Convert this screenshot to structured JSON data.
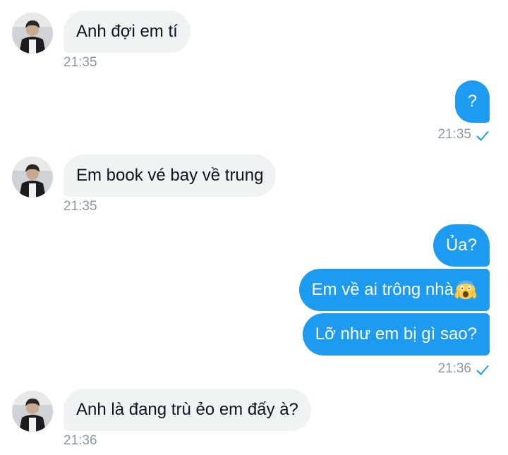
{
  "colors": {
    "outgoing_bubble": "#1d9bf0",
    "incoming_bubble": "#eff3f4",
    "timestamp": "#8b98a5",
    "read_check": "#1d9bf0"
  },
  "messages": [
    {
      "direction": "incoming",
      "text": "Anh đợi em tí",
      "time": "21:35"
    },
    {
      "direction": "outgoing",
      "text": "?",
      "time": "21:35",
      "status_icon": "check-icon"
    },
    {
      "direction": "incoming",
      "text": "Em book vé bay về trung",
      "time": "21:35"
    },
    {
      "direction": "outgoing",
      "text": "Ủa?"
    },
    {
      "direction": "outgoing",
      "text": "Em về ai trông nhà",
      "emoji": "screaming-face-emoji"
    },
    {
      "direction": "outgoing",
      "text": "Lỡ như em bị gì sao?",
      "time": "21:36",
      "status_icon": "check-icon"
    },
    {
      "direction": "incoming",
      "text": "Anh là đang trù ẻo em đấy à?",
      "time": "21:36"
    }
  ]
}
